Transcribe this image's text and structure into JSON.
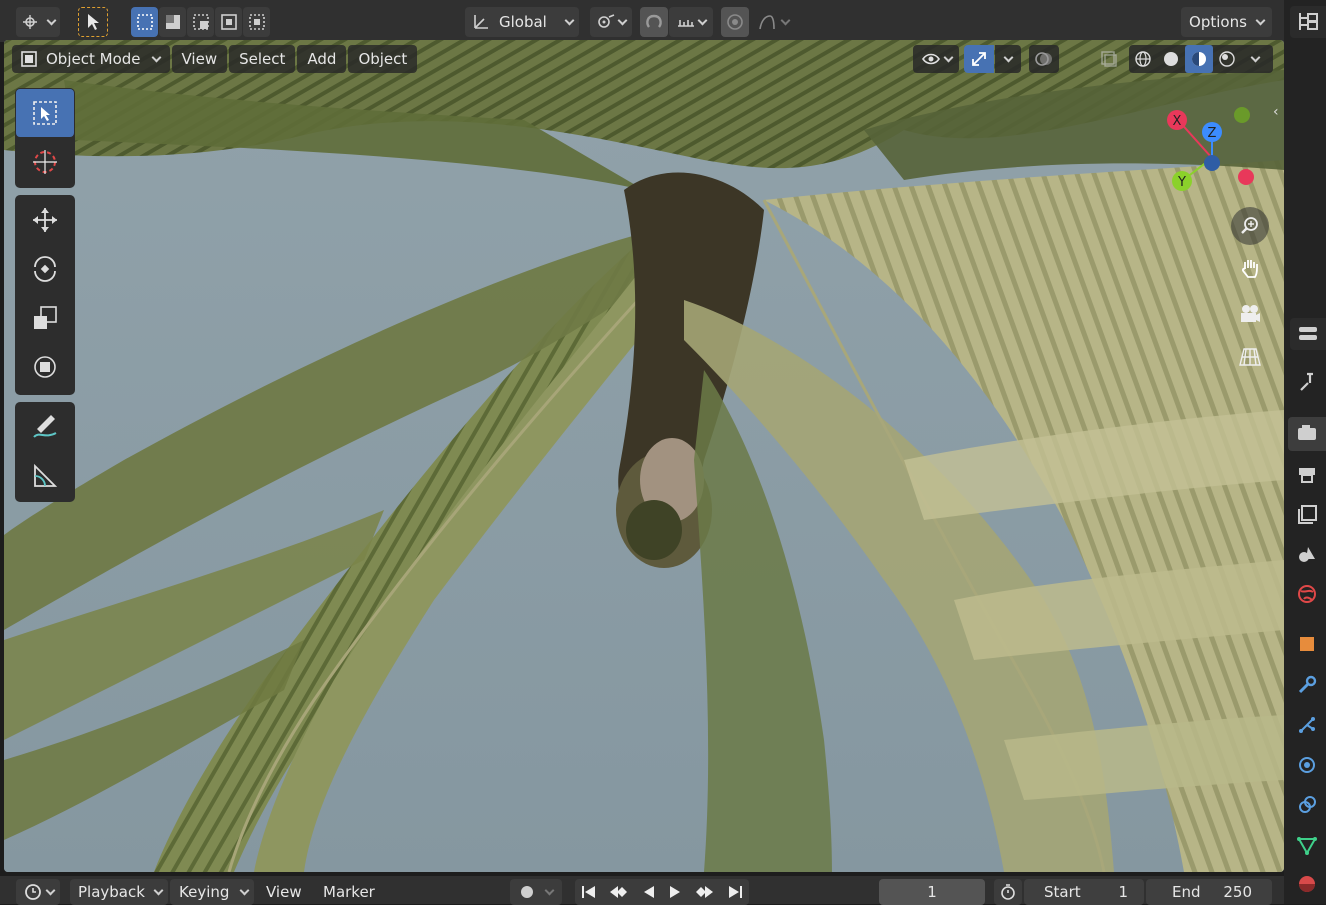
{
  "topbar": {
    "transform_orientation": "Global",
    "options_label": "Options"
  },
  "viewport_header": {
    "mode_label": "Object Mode",
    "menus": [
      "View",
      "Select",
      "Add",
      "Object"
    ]
  },
  "gizmo": {
    "x_label": "X",
    "y_label": "Y",
    "z_label": "Z",
    "x_color": "#e8385a",
    "y_color": "#8bd12b",
    "z_color": "#3c8cff"
  },
  "toolbar_tools": [
    "select-box",
    "cursor",
    "move",
    "rotate",
    "scale",
    "transform",
    "annotate",
    "measure"
  ],
  "timeline": {
    "menus": [
      "Playback",
      "Keying",
      "View",
      "Marker"
    ],
    "current_frame": "1",
    "start_label": "Start",
    "start_value": "1",
    "end_label": "End",
    "end_value": "250"
  },
  "colors": {
    "accent": "#4772b3",
    "sky": "#8b9ca4",
    "header_bg": "#303030"
  }
}
